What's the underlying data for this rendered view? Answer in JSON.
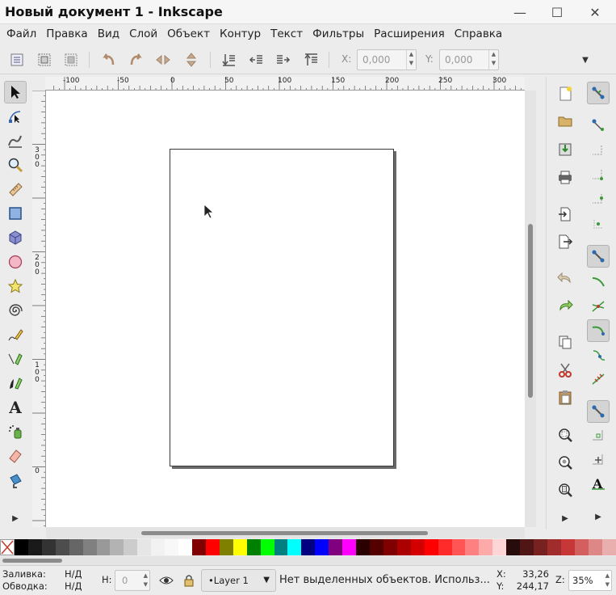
{
  "window": {
    "title": "Новый документ 1 - Inkscape",
    "minimize_glyph": "—",
    "maximize_glyph": "☐",
    "close_glyph": "✕"
  },
  "menu": [
    "Файл",
    "Правка",
    "Вид",
    "Слой",
    "Объект",
    "Контур",
    "Текст",
    "Фильтры",
    "Расширения",
    "Справка"
  ],
  "command_bar": {
    "x_label": "X:",
    "x_value": "0,000",
    "y_label": "Y:",
    "y_value": "0,000",
    "overflow_glyph": "▼"
  },
  "rulers": {
    "horizontal": [
      "-100",
      "-50",
      "0",
      "50",
      "100",
      "150",
      "200",
      "250",
      "300"
    ],
    "vertical": [
      "300",
      "200",
      "100",
      "0"
    ]
  },
  "tools": [
    {
      "name": "selector-tool",
      "icon": "arrow-cursor-icon",
      "active": true
    },
    {
      "name": "node-tool",
      "icon": "node-edit-icon"
    },
    {
      "name": "tweak-tool",
      "icon": "tweak-icon"
    },
    {
      "name": "zoom-tool",
      "icon": "magnifier-icon"
    },
    {
      "name": "measure-tool",
      "icon": "ruler-icon"
    },
    {
      "name": "rectangle-tool",
      "icon": "rectangle-icon"
    },
    {
      "name": "3d-box-tool",
      "icon": "cube-icon"
    },
    {
      "name": "ellipse-tool",
      "icon": "circle-icon"
    },
    {
      "name": "star-tool",
      "icon": "star-icon"
    },
    {
      "name": "spiral-tool",
      "icon": "spiral-icon"
    },
    {
      "name": "pencil-tool",
      "icon": "pencil-icon"
    },
    {
      "name": "pen-tool",
      "icon": "pen-icon"
    },
    {
      "name": "calligraphy-tool",
      "icon": "calligraphy-icon"
    },
    {
      "name": "text-tool",
      "icon": "text-icon",
      "glyph": "A"
    },
    {
      "name": "spray-tool",
      "icon": "spray-icon"
    },
    {
      "name": "eraser-tool",
      "icon": "eraser-icon"
    },
    {
      "name": "paint-bucket-tool",
      "icon": "bucket-icon"
    }
  ],
  "palette": {
    "colors": [
      "#000000",
      "#1a1a1a",
      "#333333",
      "#4d4d4d",
      "#666666",
      "#808080",
      "#999999",
      "#b3b3b3",
      "#cccccc",
      "#e6e6e6",
      "#f2f2f2",
      "#f8f8f8",
      "#ffffff",
      "#800000",
      "#ff0000",
      "#808000",
      "#ffff00",
      "#008000",
      "#00ff00",
      "#008080",
      "#00ffff",
      "#000080",
      "#0000ff",
      "#800080",
      "#ff00ff",
      "#2b0000",
      "#550000",
      "#800000",
      "#aa0000",
      "#d40000",
      "#ff0000",
      "#ff2a2a",
      "#ff5555",
      "#ff8080",
      "#ffaaaa",
      "#ffd5d5",
      "#280b0b",
      "#501616",
      "#782121",
      "#a02c2c",
      "#c83737",
      "#d35f5f",
      "#de8787",
      "#e9afaf"
    ]
  },
  "status": {
    "fill_label": "Заливка:",
    "fill_value": "Н/Д",
    "stroke_label": "Обводка:",
    "stroke_value": "Н/Д",
    "h_label": "H:",
    "h_value": "0",
    "layer": "•Layer 1",
    "message": "Нет выделенных объектов. Использ...",
    "x_label": "X:",
    "x_value": "33,26",
    "y_label": "Y:",
    "y_value": "244,17",
    "z_label": "Z:",
    "zoom": "35%"
  }
}
